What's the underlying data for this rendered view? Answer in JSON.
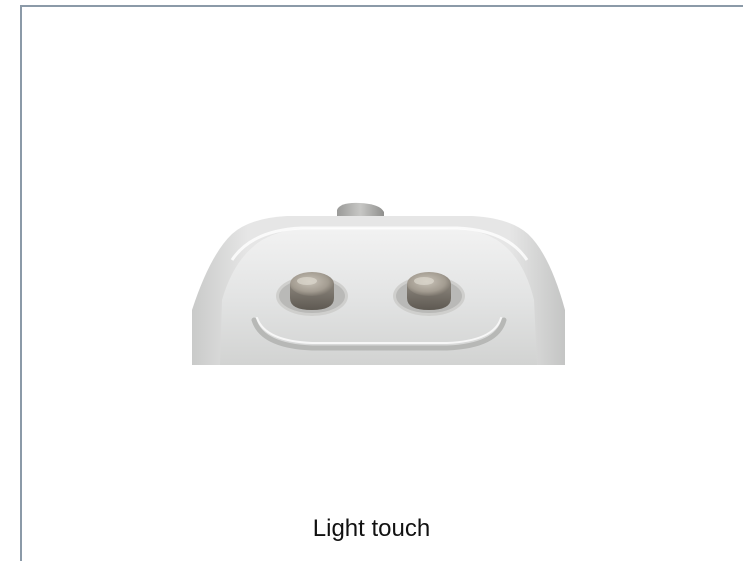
{
  "caption": {
    "text": "Light touch"
  },
  "image": {
    "subject": "foot-pedal-two-buttons"
  },
  "colors": {
    "border": "#8b9aa8",
    "background": "#ffffff"
  }
}
